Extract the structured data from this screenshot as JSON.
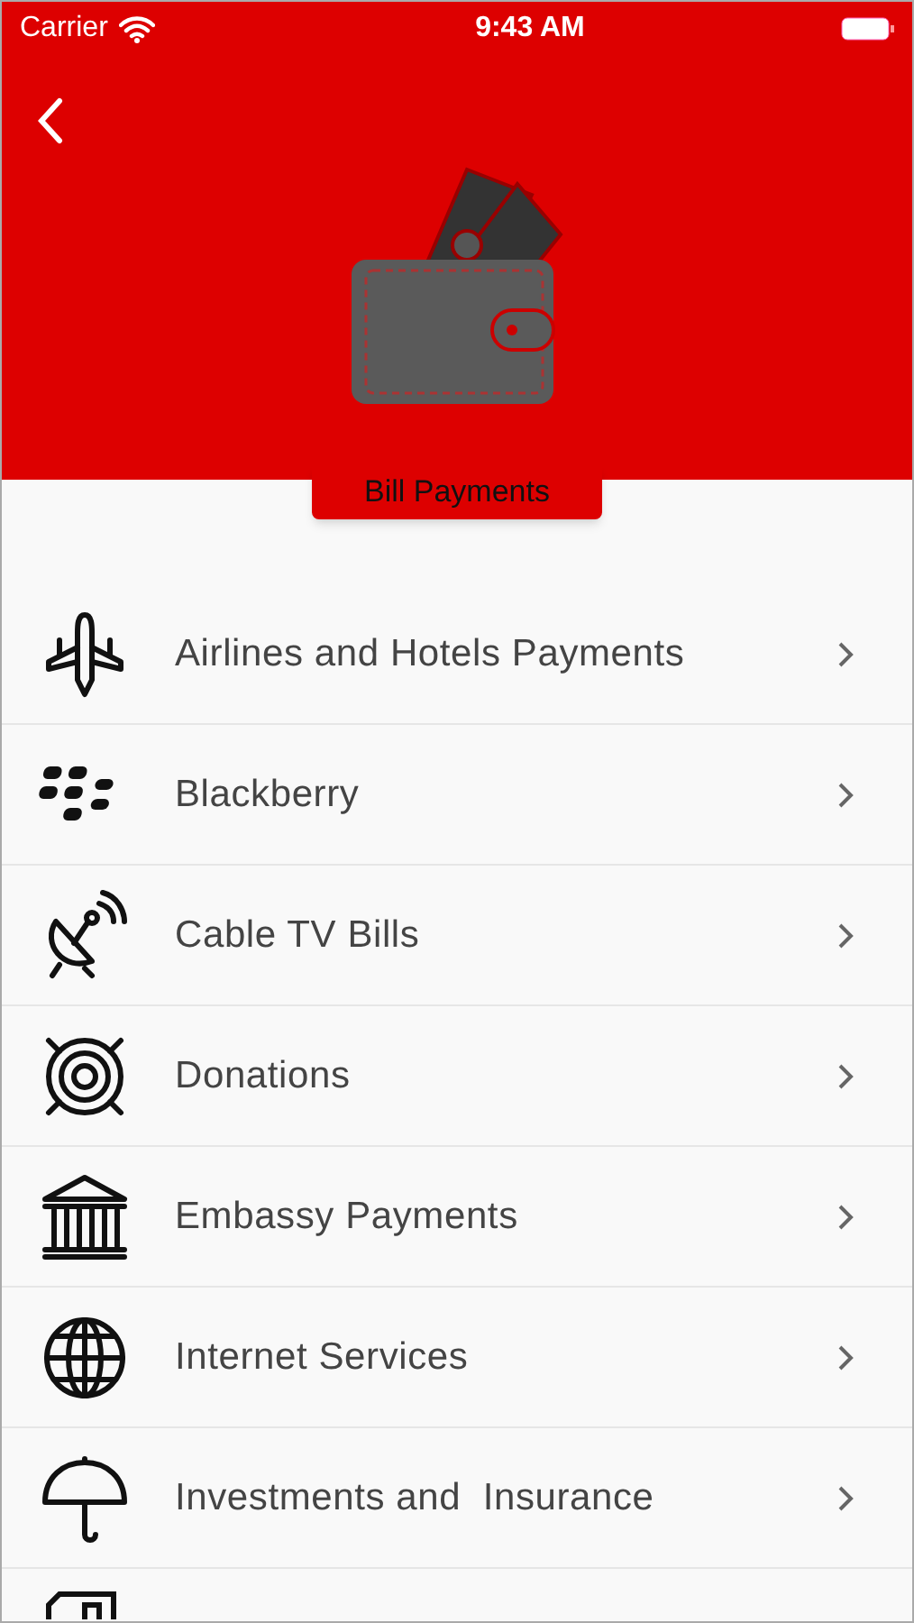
{
  "status_bar": {
    "carrier": "Carrier",
    "time": "9:43 AM"
  },
  "header": {
    "title": "Bill Payments"
  },
  "items": [
    {
      "label": "Airlines and Hotels Payments"
    },
    {
      "label": "Blackberry"
    },
    {
      "label": "Cable TV Bills"
    },
    {
      "label": "Donations"
    },
    {
      "label": "Embassy Payments"
    },
    {
      "label": "Internet Services"
    },
    {
      "label": "Investments and  Insurance"
    }
  ]
}
